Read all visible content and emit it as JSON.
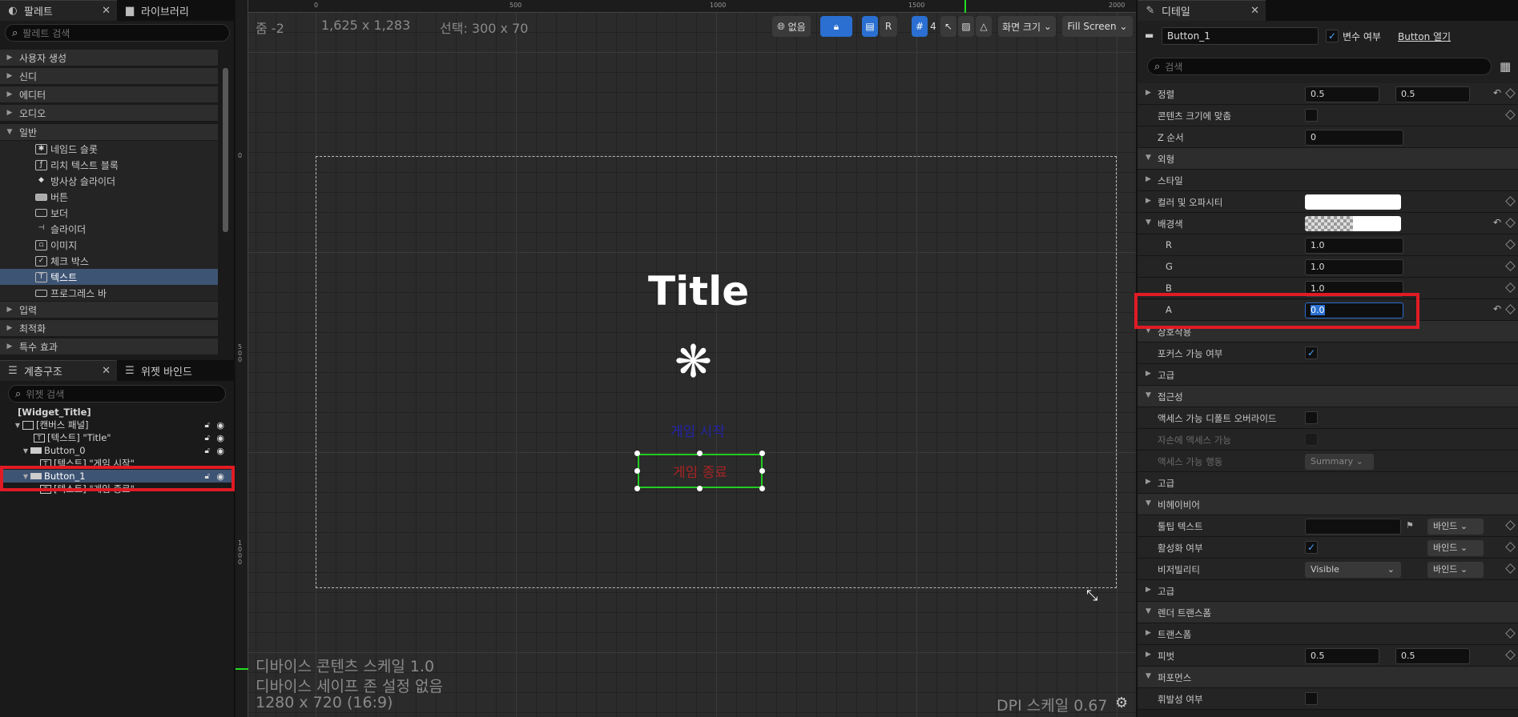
{
  "palette": {
    "tab_label": "팔레트",
    "library_tab_label": "라이브러리",
    "search_placeholder": "팔레트 검색",
    "categories": [
      "사용자 생성",
      "신디",
      "에디터",
      "오디오",
      "일반",
      "입력",
      "최적화",
      "특수 효과"
    ],
    "general_items": [
      "네임드 슬롯",
      "리치 텍스트 블록",
      "방사상 슬라이더",
      "버튼",
      "보더",
      "슬라이더",
      "이미지",
      "체크 박스",
      "텍스트",
      "프로그레스 바"
    ],
    "selected_item": "텍스트"
  },
  "hierarchy": {
    "tab_label": "계층구조",
    "binding_tab_label": "위젯 바인드",
    "search_placeholder": "위젯 검색",
    "rows": [
      "[Widget_Title]",
      "[캔버스 패널]",
      "[텍스트] \"Title\"",
      "Button_0",
      "[텍스트] \"게임 시작\"",
      "Button_1",
      "[텍스트] \"게임 종료\""
    ]
  },
  "canvas": {
    "zoom": "줌 -2",
    "resolution": "1,625 x 1,283",
    "selection": "선택: 300 x 70",
    "ruler_top": [
      "0",
      "500",
      "1000",
      "1500",
      "2000"
    ],
    "ruler_left": [
      "0",
      "5 0 0",
      "1 0 0 0"
    ],
    "toolbar": {
      "none": "없음",
      "r": "R",
      "grid": "4",
      "screen_size": "화면 크기",
      "fill_screen": "Fill Screen"
    },
    "title_text": "Title",
    "button0_text": "게임 시작",
    "button1_text": "게임 종료",
    "device_scale": "디바이스 콘텐츠 스케일 1.0",
    "safe_zone": "디바이스 세이프 존 설정 없음",
    "preview_res": "1280 x 720 (16:9)",
    "dpi": "DPI 스케일 0.67"
  },
  "details": {
    "tab_label": "디테일",
    "widget_name": "Button_1",
    "is_variable_label": "변수 여부",
    "open_button": "Button 열기",
    "search_placeholder": "검색",
    "rows": {
      "alignment": {
        "label": "정렬",
        "v1": "0.5",
        "v2": "0.5"
      },
      "size_to_content": "콘텐츠 크기에 맞춤",
      "z_order": {
        "label": "Z 순서",
        "value": "0"
      },
      "appearance": "외형",
      "style": "스타일",
      "color_opacity": "컬러 및 오파시티",
      "bg_color": "배경색",
      "r": {
        "label": "R",
        "value": "1.0"
      },
      "g": {
        "label": "G",
        "value": "1.0"
      },
      "b": {
        "label": "B",
        "value": "1.0"
      },
      "a": {
        "label": "A",
        "value": "0.0"
      },
      "interaction": "상호작용",
      "focusable": "포커스 가능 여부",
      "advanced1": "고급",
      "accessibility": "접근성",
      "acc_override": "액세스 가능 디폴트 오버라이드",
      "acc_children": "자손에 액세스 가능",
      "acc_behavior": {
        "label": "액세스 가능 행동",
        "value": "Summary"
      },
      "advanced2": "고급",
      "behavior": "비헤이비어",
      "tooltip": {
        "label": "툴팁 텍스트",
        "bind": "바인드"
      },
      "is_enabled": {
        "label": "활성화 여부",
        "bind": "바인드"
      },
      "visibility": {
        "label": "비저빌리티",
        "value": "Visible",
        "bind": "바인드"
      },
      "advanced3": "고급",
      "render_transform": "렌더 트랜스폼",
      "transform": "트랜스폼",
      "pivot": {
        "label": "피벗",
        "v1": "0.5",
        "v2": "0.5"
      },
      "performance": "퍼포먼스",
      "volatile": "휘발성 여부"
    }
  }
}
